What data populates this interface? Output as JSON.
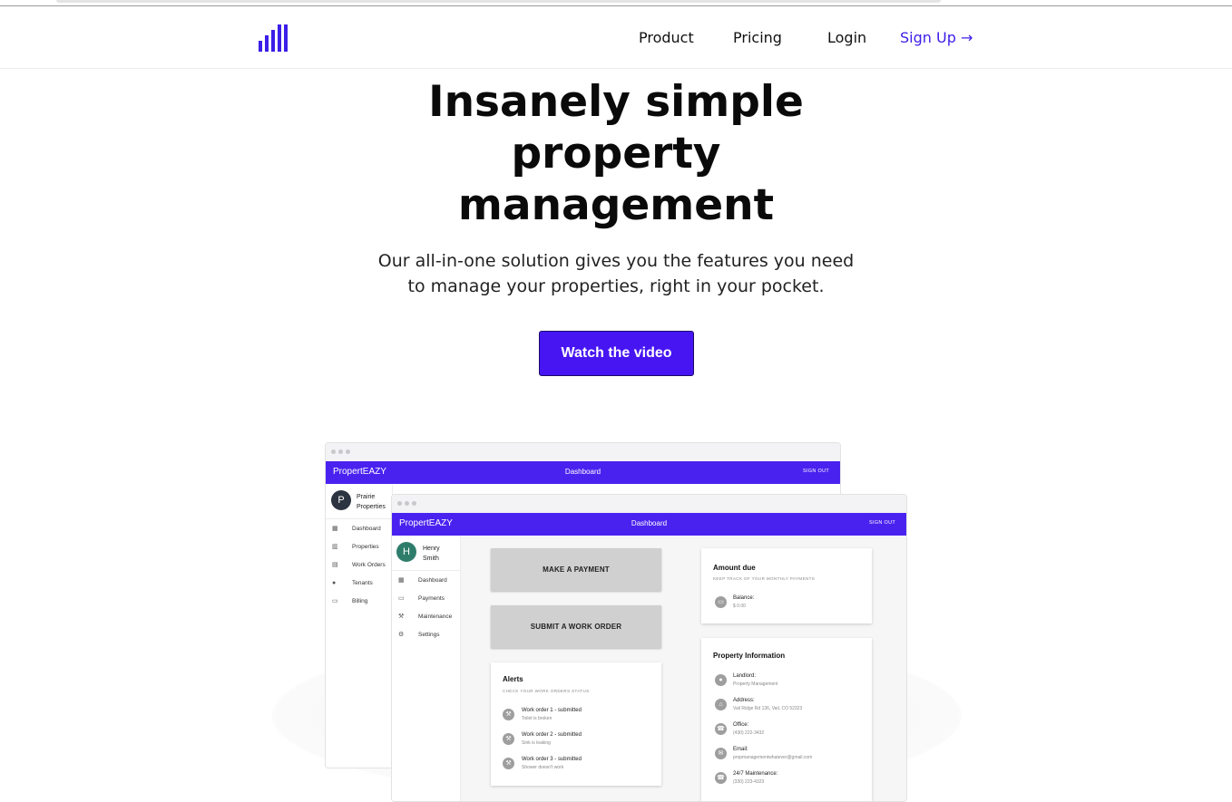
{
  "nav": {
    "links": [
      "Product",
      "Pricing",
      "Login"
    ],
    "signup": "Sign Up →",
    "accent": "#3b1ee8"
  },
  "hero": {
    "title_line1": "Insanely simple",
    "title_line2": "property",
    "title_line3": "management",
    "subtitle_line1": "Our all-in-one solution gives you the features you need",
    "subtitle_line2": "to manage your properties, right in your pocket.",
    "cta": "Watch the video",
    "cta_color": "#4715f2"
  },
  "back_window": {
    "brand": "PropertEAZY",
    "title": "Dashboard",
    "signout": "SIGN OUT",
    "avatar_letter": "P",
    "user_line1": "Prairie",
    "user_line2": "Properties",
    "menu": [
      {
        "icon": "dashboard-icon",
        "label": "Dashboard"
      },
      {
        "icon": "properties-icon",
        "label": "Properties"
      },
      {
        "icon": "clipboard-icon",
        "label": "Work Orders"
      },
      {
        "icon": "people-icon",
        "label": "Tenants"
      },
      {
        "icon": "credit-card-icon",
        "label": "Billing"
      }
    ]
  },
  "front_window": {
    "brand": "PropertEAZY",
    "title": "Dashboard",
    "signout": "SIGN OUT",
    "avatar_letter": "H",
    "user_line1": "Henry",
    "user_line2": "Smith",
    "menu": [
      {
        "icon": "dashboard-icon",
        "label": "Dashboard"
      },
      {
        "icon": "credit-card-icon",
        "label": "Payments"
      },
      {
        "icon": "wrench-icon",
        "label": "Maintenance"
      },
      {
        "icon": "gear-icon",
        "label": "Settings"
      }
    ],
    "make_payment": "MAKE A PAYMENT",
    "submit_work_order": "SUBMIT A WORK ORDER",
    "alerts": {
      "title": "Alerts",
      "subtitle": "CHECK YOUR WORK ORDERS STATUS",
      "items": [
        {
          "title": "Work order 1 - submitted",
          "detail": "Toilet is broken"
        },
        {
          "title": "Work order 2 - submitted",
          "detail": "Sink is leaking"
        },
        {
          "title": "Work order 3 - submitted",
          "detail": "Shower doesn't work"
        }
      ]
    },
    "amount_due": {
      "title": "Amount due",
      "subtitle": "KEEP TRACK OF YOUR MONTHLY PAYMENTS",
      "balance_label": "Balance:",
      "balance_value": "$ 0.00"
    },
    "property_info": {
      "title": "Property Information",
      "items": [
        {
          "icon": "person-icon",
          "label": "Landlord:",
          "value": "Property Management"
        },
        {
          "icon": "home-icon",
          "label": "Address:",
          "value": "Vail Ridge Rd 136, Vail, CO 52323"
        },
        {
          "icon": "phone-icon",
          "label": "Office:",
          "value": "(430) 222-3432"
        },
        {
          "icon": "mail-icon",
          "label": "Email:",
          "value": "propmanagementwhatever@gmail.com"
        },
        {
          "icon": "phone-icon",
          "label": "24/7 Maintenance:",
          "value": "(330) 223-4323"
        }
      ]
    }
  }
}
